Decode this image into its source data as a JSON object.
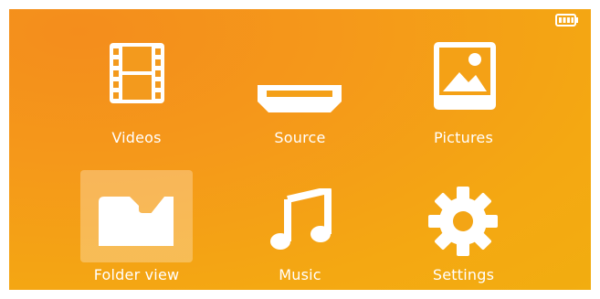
{
  "status": {
    "battery_icon": "battery-icon"
  },
  "menu": {
    "selected_index": 3,
    "items": [
      {
        "label": "Videos",
        "icon": "film-strip-icon"
      },
      {
        "label": "Source",
        "icon": "hdmi-icon"
      },
      {
        "label": "Pictures",
        "icon": "picture-icon"
      },
      {
        "label": "Folder view",
        "icon": "folder-icon"
      },
      {
        "label": "Music",
        "icon": "music-note-icon"
      },
      {
        "label": "Settings",
        "icon": "gear-icon"
      }
    ]
  },
  "colors": {
    "background_start": "#f48d1c",
    "background_end": "#f2ad10",
    "icon": "#ffffff"
  }
}
